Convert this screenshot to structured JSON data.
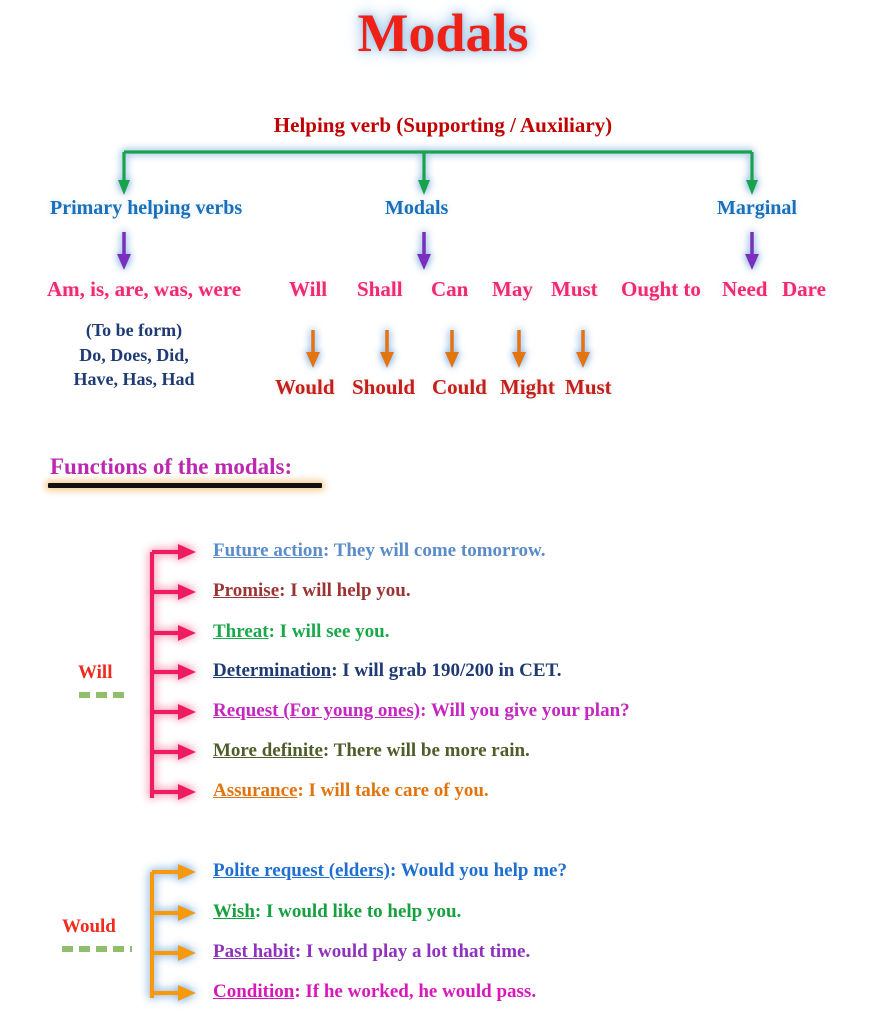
{
  "title": "Modals",
  "tree": {
    "root": "Helping verb (Supporting / Auxiliary)",
    "categories": [
      {
        "label": "Primary helping verbs"
      },
      {
        "label": "Modals"
      },
      {
        "label": "Marginal"
      }
    ],
    "primary_forms": "Am, is, are, was, were",
    "primary_note": "(To be form)\nDo, Does, Did,\nHave, Has, Had",
    "modals": [
      "Will",
      "Shall",
      "Can",
      "May",
      "Must"
    ],
    "marginal": [
      "Ought to",
      "Need",
      "Dare"
    ],
    "past_forms": [
      "Would",
      "Should",
      "Could",
      "Might",
      "Must"
    ]
  },
  "functions": {
    "heading": "Functions of the modals:",
    "groups": [
      {
        "modal": "Will",
        "items": [
          {
            "key": "Future action",
            "sep": ": ",
            "text": "They will come tomorrow."
          },
          {
            "key": "Promise",
            "sep": ": ",
            "text": "I will help you."
          },
          {
            "key": "Threat",
            "sep": ": ",
            "text": "I will see you."
          },
          {
            "key": "Determination",
            "sep": ": ",
            "text": "I will grab 190/200 in CET."
          },
          {
            "key": "Request (For young ones)",
            "sep": ": ",
            "text": "Will you give your plan?"
          },
          {
            "key": "More definite",
            "sep": ": ",
            "text": "There will be more rain."
          },
          {
            "key": "Assurance",
            "sep": ": ",
            "text": "I will take care of you."
          }
        ]
      },
      {
        "modal": "Would",
        "items": [
          {
            "key": "Polite request (elders)",
            "sep": ": ",
            "text": "Would you help me?"
          },
          {
            "key": "Wish",
            "sep": ": ",
            "text": "I would like to help you."
          },
          {
            "key": "Past habit",
            "sep": ": ",
            "text": "I would play a lot that time."
          },
          {
            "key": "Condition",
            "sep": ": ",
            "text": "If he worked, he would pass."
          }
        ]
      }
    ]
  },
  "colors": {
    "title": "#ef2016",
    "root": "#c00000",
    "category": "#1a6fb8",
    "pink_row": "#ef2a72",
    "navy": "#1f3b73",
    "dark_red": "#c2201b",
    "heading": "#bc29b0",
    "green_connector": "#16a34a",
    "purple_arrow": "#7b2fbe",
    "orange_arrow": "#e2740f",
    "pink_bracket": "#ef1f62",
    "glow_blue": "#9ec6e8",
    "dash_green": "#8fbf6a"
  }
}
